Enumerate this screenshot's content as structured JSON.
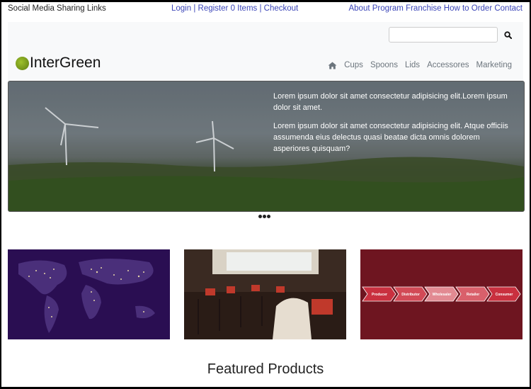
{
  "topbar": {
    "social": "Social Media Sharing Links",
    "login": "Login",
    "register": "Register",
    "items": "0 Items",
    "checkout": "Checkout",
    "about": "About",
    "program": "Program",
    "franchise": "Franchise",
    "how_to_order": "How to Order",
    "contact": "Contact"
  },
  "header": {
    "search_placeholder": "",
    "logo_text": "InterGreen",
    "nav": [
      "Cups",
      "Spoons",
      "Lids",
      "Accessores",
      "Marketing"
    ]
  },
  "hero": {
    "paragraph1": "Lorem ipsum dolor sit amet consectetur adipisicing elit.Lorem ipsum dolor sit amet.",
    "paragraph2": "Lorem ipsum dolor sit amet consectetur adipisicing elit. Atque officiis assumenda eius delectus quasi beatae dicta omnis dolorem asperiores quisquam?",
    "slide_count": 3
  },
  "tiles": {
    "chain": [
      "Producer",
      "Distributor",
      "Wholesaler",
      "Retailer",
      "Consumer"
    ]
  },
  "featured_title": "Featured Products",
  "colors": {
    "link": "#3b45b8",
    "header_bg": "#f8f9fa",
    "logo_green": "#8db227",
    "tile3_bg": "#6e1520"
  }
}
